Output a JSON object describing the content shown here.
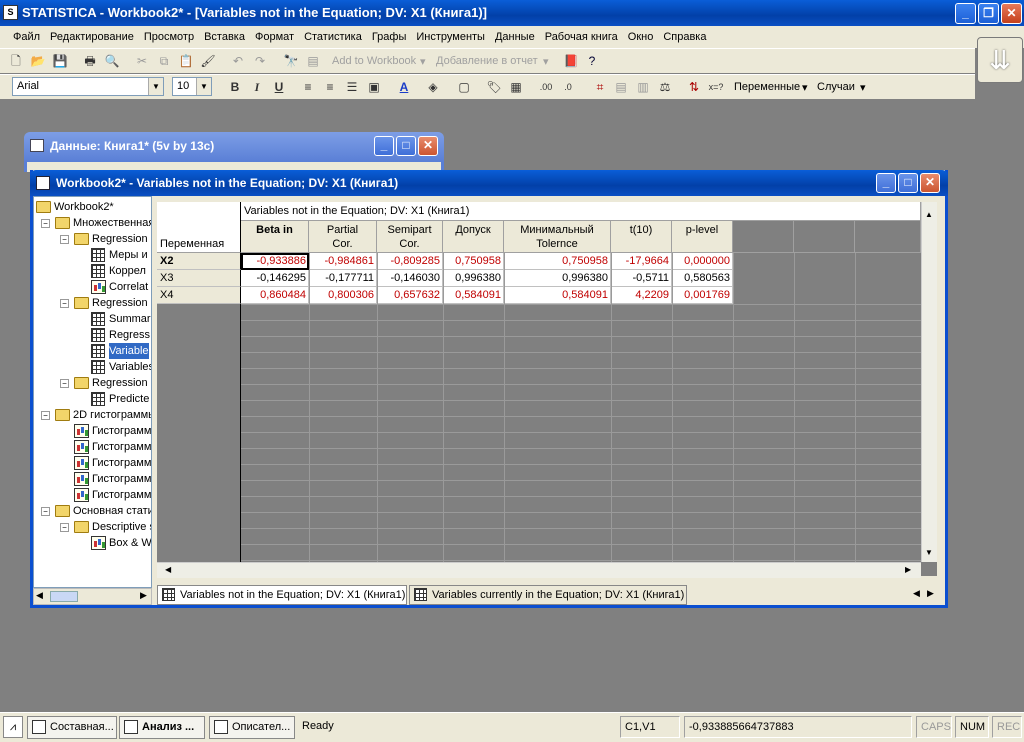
{
  "app": {
    "title": "STATISTICA - Workbook2* - [Variables not in the Equation; DV: X1 (Книга1)]"
  },
  "menu": [
    "Файл",
    "Редактирование",
    "Просмотр",
    "Вставка",
    "Формат",
    "Статистика",
    "Графы",
    "Инструменты",
    "Данные",
    "Рабочая книга",
    "Окно",
    "Справка"
  ],
  "toolbar1": {
    "add_to_workbook": "Add to Workbook",
    "add_to_report": "Добавление в отчет"
  },
  "toolbar2": {
    "font": "Arial",
    "size": "10",
    "variables": "Переменные",
    "cases": "Случаи"
  },
  "data_window": {
    "title": "Данные: Книга1* (5v by 13c)"
  },
  "workbook": {
    "title": "Workbook2* - Variables not in the Equation; DV: X1 (Книга1)"
  },
  "tree": [
    {
      "label": "Workbook2*",
      "level": 0,
      "icon": "folder-icon",
      "toggle": ""
    },
    {
      "label": "Множественная",
      "level": 1,
      "icon": "folder-icon",
      "toggle": "−"
    },
    {
      "label": "Regression r",
      "level": 2,
      "icon": "folder-icon",
      "toggle": "−"
    },
    {
      "label": "Меры и",
      "level": 3,
      "icon": "sheet-icon",
      "toggle": ""
    },
    {
      "label": "Коррел",
      "level": 3,
      "icon": "sheet-icon",
      "toggle": ""
    },
    {
      "label": "Correlat",
      "level": 3,
      "icon": "graph-icon",
      "toggle": ""
    },
    {
      "label": "Regression r",
      "level": 2,
      "icon": "folder-icon",
      "toggle": "−"
    },
    {
      "label": "Summar",
      "level": 3,
      "icon": "sheet-icon",
      "toggle": ""
    },
    {
      "label": "Regress",
      "level": 3,
      "icon": "sheet-icon",
      "toggle": ""
    },
    {
      "label": "Variable",
      "level": 3,
      "icon": "sheet-icon",
      "toggle": "",
      "selected": true
    },
    {
      "label": "Variables",
      "level": 3,
      "icon": "sheet-icon",
      "toggle": ""
    },
    {
      "label": "Regression r",
      "level": 2,
      "icon": "folder-icon",
      "toggle": "−"
    },
    {
      "label": "Predicte",
      "level": 3,
      "icon": "sheet-icon",
      "toggle": ""
    },
    {
      "label": "2D гистограммы",
      "level": 1,
      "icon": "folder-icon",
      "toggle": "−"
    },
    {
      "label": "Гистограмм",
      "level": 2,
      "icon": "graph-icon",
      "toggle": ""
    },
    {
      "label": "Гистограмм",
      "level": 2,
      "icon": "graph-icon",
      "toggle": ""
    },
    {
      "label": "Гистограмм",
      "level": 2,
      "icon": "graph-icon",
      "toggle": ""
    },
    {
      "label": "Гистограмм",
      "level": 2,
      "icon": "graph-icon",
      "toggle": ""
    },
    {
      "label": "Гистограмм",
      "level": 2,
      "icon": "graph-icon",
      "toggle": ""
    },
    {
      "label": "Основная стати",
      "level": 1,
      "icon": "folder-icon",
      "toggle": "−"
    },
    {
      "label": "Descriptive s",
      "level": 2,
      "icon": "folder-icon",
      "toggle": "−"
    },
    {
      "label": "Box & W",
      "level": 3,
      "icon": "graph-icon",
      "toggle": ""
    }
  ],
  "table": {
    "caption": "Variables not in the Equation; DV: X1 (Книга1)",
    "row_header_title": "Переменная",
    "columns": [
      {
        "line1": "Beta in",
        "line2": "",
        "bold": true
      },
      {
        "line1": "Partial",
        "line2": "Cor."
      },
      {
        "line1": "Semipart",
        "line2": "Cor."
      },
      {
        "line1": "Допуск",
        "line2": ""
      },
      {
        "line1": "Минимальный",
        "line2": "Tolernce"
      },
      {
        "line1": "t(10)",
        "line2": ""
      },
      {
        "line1": "p-level",
        "line2": ""
      }
    ],
    "rows": [
      {
        "name": "X2",
        "red": true,
        "values": [
          "-0,933886",
          "-0,984861",
          "-0,809285",
          "0,750958",
          "0,750958",
          "-17,9664",
          "0,000000"
        ]
      },
      {
        "name": "X3",
        "red": false,
        "values": [
          "-0,146295",
          "-0,177711",
          "-0,146030",
          "0,996380",
          "0,996380",
          "-0,5711",
          "0,580563"
        ]
      },
      {
        "name": "X4",
        "red": true,
        "values": [
          "0,860484",
          "0,800306",
          "0,657632",
          "0,584091",
          "0,584091",
          "4,2209",
          "0,001769"
        ]
      }
    ]
  },
  "tabs": [
    {
      "label": "Variables not in the Equation; DV: X1 (Книга1)",
      "active": true
    },
    {
      "label": "Variables currently in the Equation; DV: X1 (Книга1)",
      "active": false
    }
  ],
  "taskbar": [
    {
      "label": "Составная..."
    },
    {
      "label": "Анализ ...",
      "bold": true
    },
    {
      "label": "Описател..."
    }
  ],
  "status": {
    "ready": "Ready",
    "cell": "C1,V1",
    "value": "-0,933885664737883",
    "caps": "CAPS",
    "num": "NUM",
    "rec": "REC"
  },
  "colors": {
    "titlebar": "#0a5ed8",
    "red_values": "#c00000",
    "selection": "#316ac5"
  }
}
